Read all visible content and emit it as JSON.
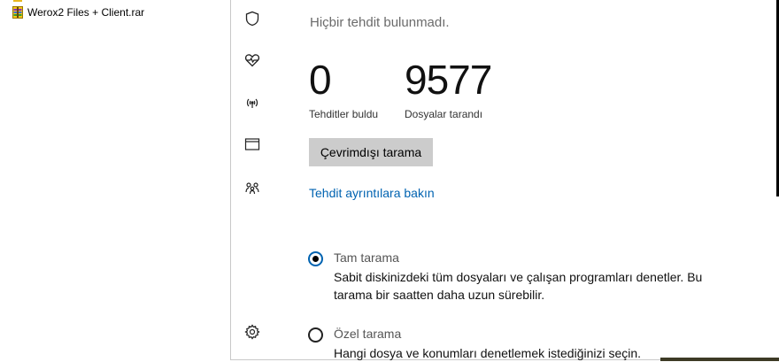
{
  "explorer": {
    "files": [
      {
        "name": "Werox2 Files + Client.rar",
        "icon": "winrar-archive-icon"
      }
    ]
  },
  "defender": {
    "nav_icons": [
      "shield-icon",
      "heart-icon",
      "wifi-icon",
      "browser-window-icon",
      "family-icon",
      "settings-icon"
    ],
    "status_text": "Hiçbir tehdit bulunmadı.",
    "threats_found": {
      "value": "0",
      "label": "Tehditler buldu"
    },
    "files_scanned": {
      "value": "9577",
      "label": "Dosyalar tarandı"
    },
    "offline_scan_button": "Çevrimdışı tarama",
    "details_link": "Tehdit ayrıntılara bakın",
    "scan_options": [
      {
        "title": "Tam tarama",
        "description": "Sabit diskinizdeki tüm dosyaları ve çalışan programları denetler. Bu tarama bir saatten daha uzun sürebilir.",
        "selected": true
      },
      {
        "title": "Özel tarama",
        "description": "Hangi dosya ve konumları denetlemek istediğinizi seçin.",
        "selected": false
      }
    ],
    "colors": {
      "link": "#0063b1",
      "button_bg": "#cccccc",
      "status_gray": "#6b6b6b"
    }
  }
}
